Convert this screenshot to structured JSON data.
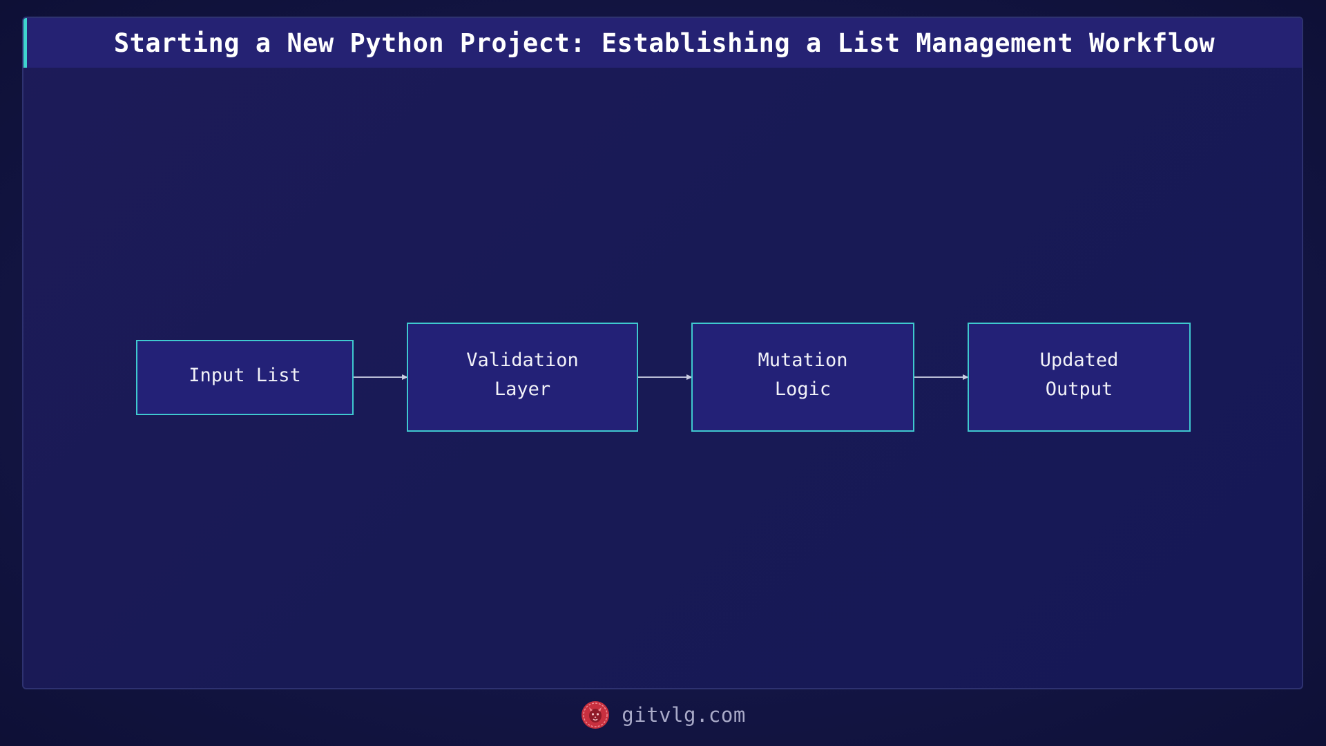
{
  "title": "Starting a New Python Project: Establishing a List Management Workflow",
  "nodes": [
    {
      "id": "input",
      "label": "Input List"
    },
    {
      "id": "validation",
      "label": "Validation\nLayer"
    },
    {
      "id": "mutation",
      "label": "Mutation\nLogic"
    },
    {
      "id": "output",
      "label": "Updated\nOutput"
    }
  ],
  "edges": [
    {
      "from": "input",
      "to": "validation"
    },
    {
      "from": "validation",
      "to": "mutation"
    },
    {
      "from": "mutation",
      "to": "output"
    }
  ],
  "footer": {
    "site": "gitvlg.com",
    "logo_icon": "lion-head-icon"
  },
  "colors": {
    "accent": "#3fd4cf",
    "node_fill": "#232177",
    "logo": "#d23a4a"
  }
}
